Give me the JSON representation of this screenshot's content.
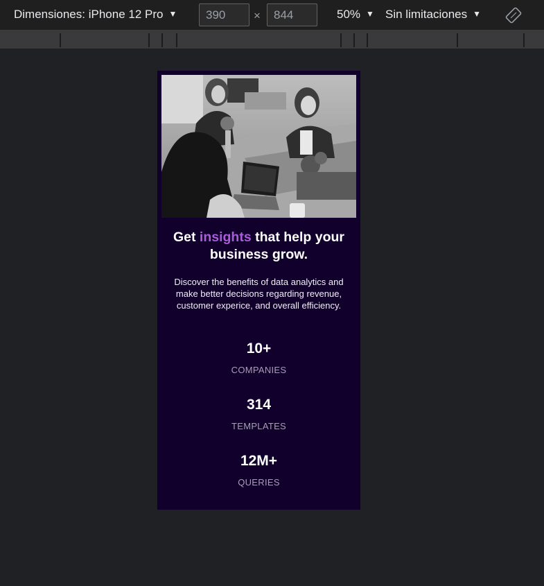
{
  "toolbar": {
    "device_label": "Dimensiones: iPhone 12 Pro",
    "width_value": "390",
    "height_value": "844",
    "times": "×",
    "zoom": "50%",
    "throttling": "Sin limitaciones",
    "rotate_icon": "rotate-icon"
  },
  "page": {
    "headline_pre": "Get ",
    "headline_accent": "insights",
    "headline_post": " that help your business grow.",
    "description": "Discover the benefits of data analytics and make better decisions regarding revenue, customer experice, and overall efficiency.",
    "stats": [
      {
        "value": "10+",
        "label": "COMPANIES"
      },
      {
        "value": "314",
        "label": "TEMPLATES"
      },
      {
        "value": "12M+",
        "label": "QUERIES"
      }
    ]
  },
  "colors": {
    "card_bg": "#10002b",
    "accent": "#aa5cdb",
    "stat_label": "#a79fb8"
  }
}
